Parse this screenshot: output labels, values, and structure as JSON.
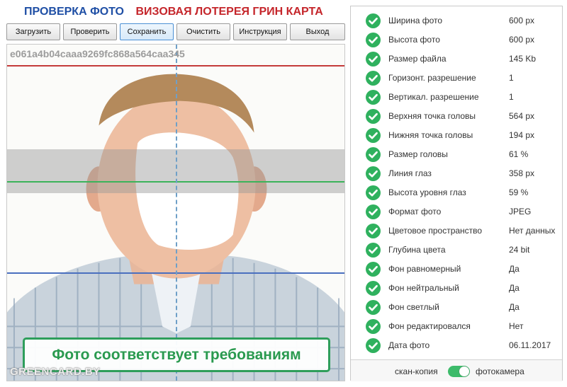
{
  "header": {
    "title_left": "ПРОВЕРКА ФОТО",
    "title_right": "ВИЗОВАЯ ЛОТЕРЕЯ ГРИН КАРТА"
  },
  "toolbar": {
    "buttons": [
      {
        "label": "Загрузить"
      },
      {
        "label": "Проверить"
      },
      {
        "label": "Сохранить",
        "active": true
      },
      {
        "label": "Очистить"
      },
      {
        "label": "Инструкция"
      },
      {
        "label": "Выход"
      }
    ]
  },
  "photo": {
    "id": "e061a4b04caaa9269fc868a564caa345",
    "status_message": "Фото соответствует требованиям",
    "watermark": "GREENCARD.BY"
  },
  "checks": [
    {
      "label": "Ширина фото",
      "value": "600 px",
      "status": "ok"
    },
    {
      "label": "Высота фото",
      "value": "600 px",
      "status": "ok"
    },
    {
      "label": "Размер файла",
      "value": "145 Kb",
      "status": "ok"
    },
    {
      "label": "Горизонт. разрешение",
      "value": "1",
      "status": "ok"
    },
    {
      "label": "Вертикал. разрешение",
      "value": "1",
      "status": "ok"
    },
    {
      "label": "Верхняя точка головы",
      "value": "564 px",
      "status": "ok"
    },
    {
      "label": "Нижняя точка головы",
      "value": "194 px",
      "status": "ok"
    },
    {
      "label": "Размер головы",
      "value": "61 %",
      "status": "ok"
    },
    {
      "label": "Линия глаз",
      "value": "358 px",
      "status": "ok"
    },
    {
      "label": "Высота уровня глаз",
      "value": "59 %",
      "status": "ok"
    },
    {
      "label": "Формат фото",
      "value": "JPEG",
      "status": "ok"
    },
    {
      "label": "Цветовое пространство",
      "value": "Нет данных",
      "status": "ok"
    },
    {
      "label": "Глубина цвета",
      "value": "24 bit",
      "status": "ok"
    },
    {
      "label": "Фон равномерный",
      "value": "Да",
      "status": "ok"
    },
    {
      "label": "Фон нейтральный",
      "value": "Да",
      "status": "ok"
    },
    {
      "label": "Фон светлый",
      "value": "Да",
      "status": "ok"
    },
    {
      "label": "Фон редактировался",
      "value": "Нет",
      "status": "ok"
    },
    {
      "label": "Дата фото",
      "value": "06.11.2017",
      "status": "ok"
    }
  ],
  "mode_switch": {
    "left_label": "скан-копия",
    "right_label": "фотокамера",
    "selected": "фотокамера"
  },
  "colors": {
    "title_blue": "#1f4fa5",
    "title_red": "#c5262b",
    "ok_green": "#2fb15e",
    "status_green": "#2a9a4f",
    "toggle_green": "#3dbb6a"
  },
  "icons": {
    "check_status": "check-circle-icon"
  }
}
